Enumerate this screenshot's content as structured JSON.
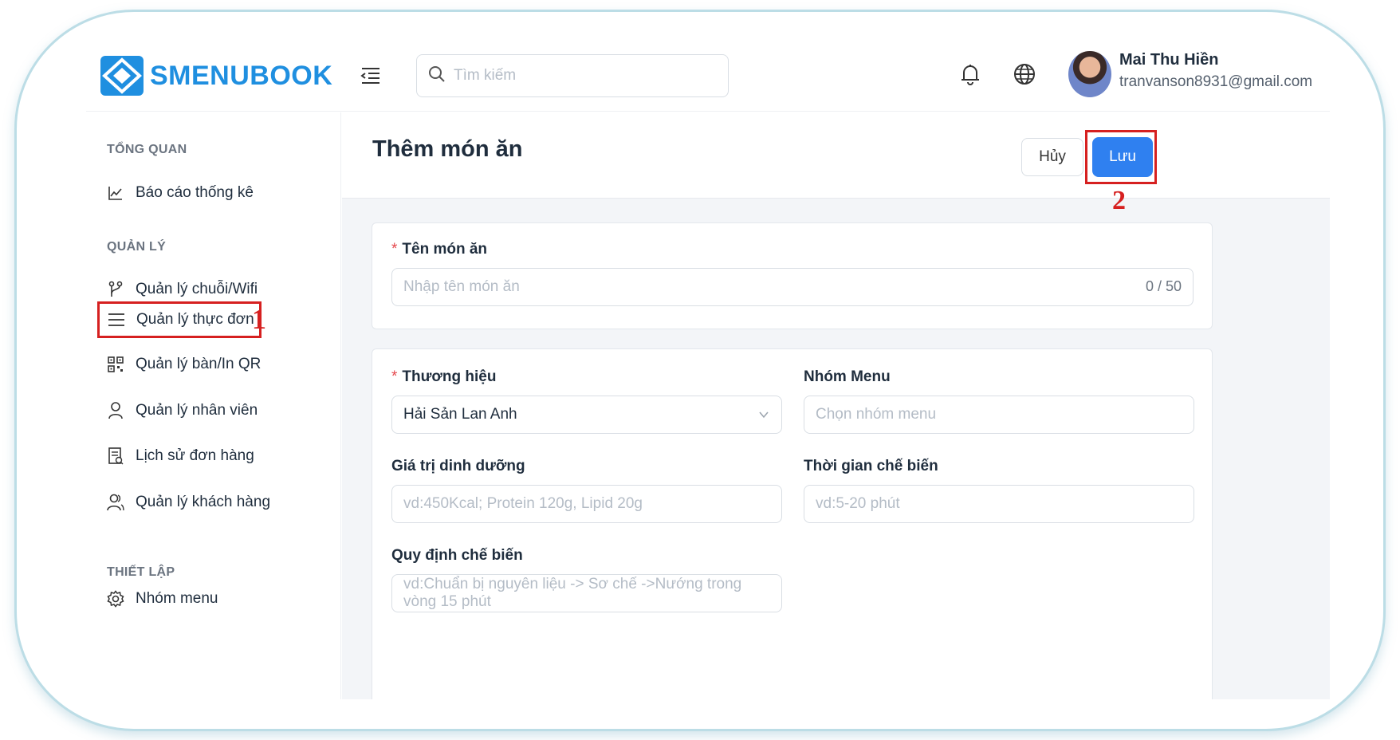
{
  "header": {
    "logo_text": "SMENUBOOK",
    "search_placeholder": "Tìm kiếm",
    "user": {
      "name": "Mai Thu Hiền",
      "email": "tranvanson8931@gmail.com"
    }
  },
  "sidebar": {
    "sections": [
      {
        "title": "TỔNG QUAN",
        "items": [
          {
            "label": "Báo cáo thống kê",
            "icon": "chart-line-icon"
          }
        ]
      },
      {
        "title": "QUẢN LÝ",
        "items": [
          {
            "label": "Quản lý chuỗi/Wifi",
            "icon": "branch-icon"
          },
          {
            "label": "Quản lý thực đơn",
            "icon": "menu-list-icon"
          },
          {
            "label": "Quản lý bàn/In QR",
            "icon": "qr-code-icon"
          },
          {
            "label": "Quản lý nhân viên",
            "icon": "user-icon"
          },
          {
            "label": "Lịch sử đơn hàng",
            "icon": "order-history-icon"
          },
          {
            "label": "Quản lý khách hàng",
            "icon": "customers-icon"
          }
        ]
      },
      {
        "title": "THIẾT LẬP",
        "items": [
          {
            "label": "Nhóm menu",
            "icon": "gear-icon"
          }
        ]
      }
    ]
  },
  "annotations": {
    "marker_1": "1",
    "marker_2": "2"
  },
  "page": {
    "title": "Thêm món ăn",
    "cancel_label": "Hủy",
    "save_label": "Lưu",
    "dish_name": {
      "label": "Tên món ăn",
      "placeholder": "Nhập tên món ăn",
      "counter": "0 / 50"
    },
    "brand": {
      "label": "Thương hiệu",
      "value": "Hải Sản Lan Anh"
    },
    "menu_group": {
      "label": "Nhóm Menu",
      "placeholder": "Chọn nhóm menu"
    },
    "nutrition": {
      "label": "Giá trị dinh dưỡng",
      "placeholder": "vd:450Kcal; Protein 120g, Lipid 20g"
    },
    "cook_time": {
      "label": "Thời gian chế biến",
      "placeholder": "vd:5-20 phút"
    },
    "process": {
      "label": "Quy định chế biến",
      "placeholder": "vd:Chuẩn bị nguyên liệu -> Sơ chế ->Nướng trong vòng 15 phút"
    }
  },
  "colors": {
    "brand": "#1f8fe0",
    "primary_button": "#2f80f0",
    "highlight": "#d62020"
  }
}
